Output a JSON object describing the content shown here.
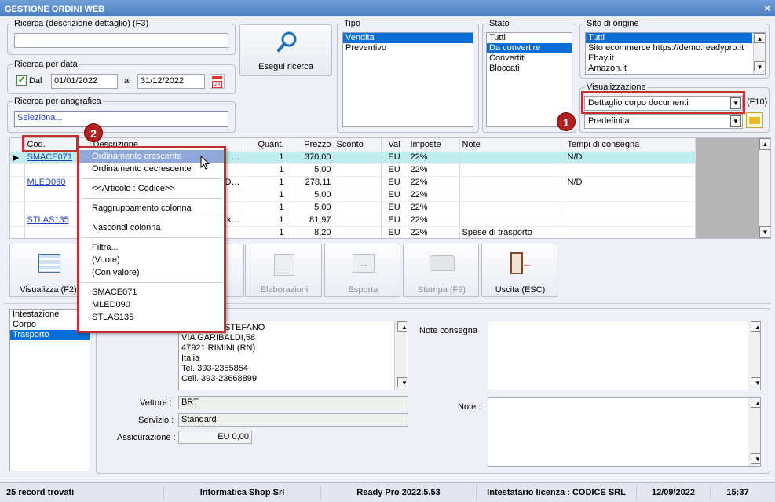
{
  "window": {
    "title": "GESTIONE ORDINI WEB",
    "close": "×"
  },
  "search": {
    "group_label": "Ricerca (descrizione dettaglio) (F3)",
    "value": "",
    "button_label": "Esegui ricerca"
  },
  "date_search": {
    "group_label": "Ricerca per data",
    "dal_label": "Dal",
    "from": "01/01/2022",
    "al_label": "al",
    "to": "31/12/2022"
  },
  "anagrafica": {
    "group_label": "Ricerca per anagrafica",
    "value": "Seleziona..."
  },
  "tipo": {
    "label": "Tipo",
    "items": [
      "Vendita",
      "Preventivo"
    ],
    "selected": 0
  },
  "stato": {
    "label": "Stato",
    "items": [
      "Tutti",
      "Da convertire",
      "Convertiti",
      "Bloccati"
    ],
    "selected": 1
  },
  "sito": {
    "label": "Sito di origine",
    "items": [
      "Tutti",
      "Sito ecommerce https://demo.readypro.it",
      "Ebay.it",
      "Amazon.it"
    ],
    "selected": 0
  },
  "visualizzazione": {
    "label": "Visualizzazione",
    "mode": "Dettaglio corpo documenti",
    "shortcut": "(F10)",
    "preset": "Predefinita"
  },
  "badges": {
    "one": "1",
    "two": "2"
  },
  "grid": {
    "columns": [
      "Cod.",
      "Descrizione",
      "Quant.",
      "Prezzo",
      "Sconto",
      "Val",
      "Imposte",
      "Note",
      "Tempi di consegna"
    ],
    "rows": [
      {
        "cod": "SMACE071",
        "desc": "…",
        "qty": "1",
        "price": "370,00",
        "sconto": "",
        "val": "EU",
        "imposte": "22%",
        "note": "",
        "tempi": "N/D"
      },
      {
        "cod": "",
        "desc": "",
        "qty": "1",
        "price": "5,00",
        "sconto": "",
        "val": "EU",
        "imposte": "22%",
        "note": "",
        "tempi": ""
      },
      {
        "cod": "MLED090",
        "desc": "D…",
        "qty": "1",
        "price": "278,11",
        "sconto": "",
        "val": "EU",
        "imposte": "22%",
        "note": "",
        "tempi": "N/D"
      },
      {
        "cod": "",
        "desc": "",
        "qty": "1",
        "price": "5,00",
        "sconto": "",
        "val": "EU",
        "imposte": "22%",
        "note": "",
        "tempi": ""
      },
      {
        "cod": "",
        "desc": "",
        "qty": "1",
        "price": "5,00",
        "sconto": "",
        "val": "EU",
        "imposte": "22%",
        "note": "",
        "tempi": ""
      },
      {
        "cod": "STLAS135",
        "desc": "k…",
        "qty": "1",
        "price": "81,97",
        "sconto": "",
        "val": "EU",
        "imposte": "22%",
        "note": "",
        "tempi": ""
      },
      {
        "cod": "",
        "desc": "",
        "qty": "1",
        "price": "8,20",
        "sconto": "",
        "val": "EU",
        "imposte": "22%",
        "note": "Spese di trasporto",
        "tempi": ""
      }
    ]
  },
  "context_menu": {
    "items": [
      "Ordinamento crescente",
      "Ordinamento decrescente",
      "<<Articolo : Codice>>",
      "Raggruppamento colonna",
      "Nascondi colonna",
      "Filtra...",
      "(Vuote)",
      "(Con valore)",
      "SMACE071",
      "MLED090",
      "STLAS135"
    ]
  },
  "toolbar": {
    "visualizza": "Visualizza (F2)",
    "partial": "ti",
    "elaborazioni": "Elaborazioni",
    "esporta": "Esporta",
    "stampa": "Stampa (F9)",
    "uscita": "Uscita (ESC)"
  },
  "tabs": {
    "items": [
      "Intestazione",
      "Corpo",
      "Trasporto"
    ],
    "selected": 2
  },
  "trasporto": {
    "address_lines": [
      "STEFANO",
      "VIA GARIBALDI,58",
      "47921 RIMINI (RN)",
      "Italia",
      "Tel. 393-2355854",
      "Cell. 393-23668899"
    ],
    "vettore_label": "Vettore :",
    "vettore": "BRT",
    "servizio_label": "Servizio :",
    "servizio": "Standard",
    "assicurazione_label": "Assicurazione :",
    "assicurazione": "EU 0,00",
    "note_consegna_label": "Note consegna :",
    "note_label": "Note :"
  },
  "status": {
    "records": "25 record trovati",
    "company": "Informatica Shop Srl",
    "version": "Ready Pro 2022.5.53",
    "license": "Intestatario licenza : CODICE SRL",
    "date": "12/09/2022",
    "time": "15:37"
  }
}
